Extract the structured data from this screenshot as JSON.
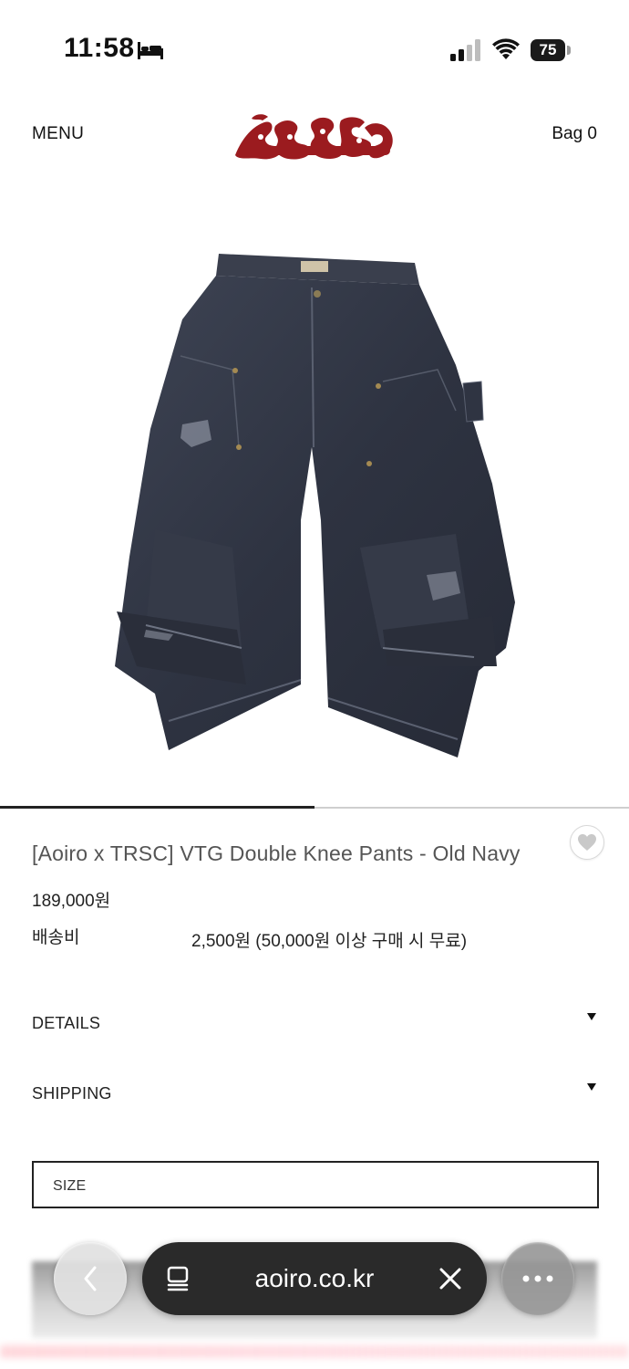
{
  "status_bar": {
    "time": "11:58",
    "battery": "75",
    "icons": [
      "bed-icon",
      "signal-icon",
      "wifi-icon",
      "battery-icon"
    ]
  },
  "header": {
    "menu_label": "MENU",
    "bag_label": "Bag 0",
    "logo": "aoiro-logo",
    "logo_color": "#9b1b1f"
  },
  "gallery": {
    "image": "double-knee-pants-photo",
    "progress": 0.5
  },
  "product": {
    "title": "[Aoiro x TRSC] VTG Double Knee Pants - Old Navy",
    "price": "189,000원",
    "shipping_label": "배송비",
    "shipping_value": "2,500원 (50,000원 이상 구매 시 무료)",
    "wishlist_icon": "heart-icon"
  },
  "accordions": [
    {
      "label": "DETAILS"
    },
    {
      "label": "SHIPPING"
    }
  ],
  "size_select": {
    "label": "SIZE"
  },
  "browser": {
    "url": "aoiro.co.kr",
    "icons": [
      "back-icon",
      "tabs-icon",
      "clear-icon",
      "more-icon"
    ]
  }
}
